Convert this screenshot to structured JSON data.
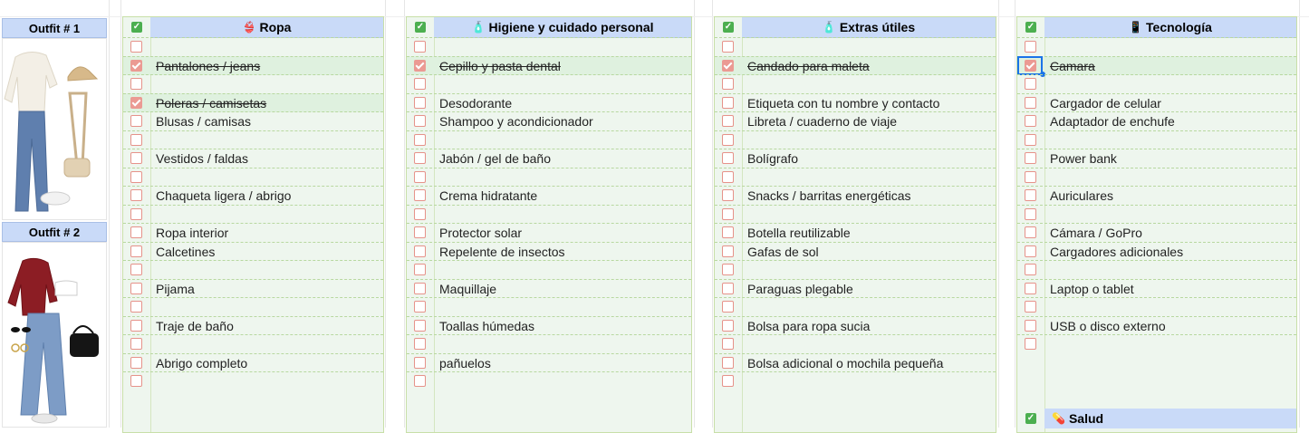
{
  "outfits": [
    {
      "label": "Outfit # 1"
    },
    {
      "label": "Outfit # 2"
    }
  ],
  "categories": [
    {
      "title": "Ropa",
      "icon": "bikini-icon",
      "icon_glyph": "👙",
      "rows": [
        {
          "label": "",
          "checked": false
        },
        {
          "label": "Pantalones / jeans",
          "checked": true
        },
        {
          "label": "",
          "checked": false
        },
        {
          "label": "Poleras / camisetas",
          "checked": true
        },
        {
          "label": "Blusas / camisas",
          "checked": false
        },
        {
          "label": "",
          "checked": false
        },
        {
          "label": "Vestidos / faldas",
          "checked": false
        },
        {
          "label": "",
          "checked": false
        },
        {
          "label": "Chaqueta ligera / abrigo",
          "checked": false
        },
        {
          "label": "",
          "checked": false
        },
        {
          "label": "Ropa interior",
          "checked": false
        },
        {
          "label": "Calcetines",
          "checked": false
        },
        {
          "label": "",
          "checked": false
        },
        {
          "label": "Pijama",
          "checked": false
        },
        {
          "label": "",
          "checked": false
        },
        {
          "label": "Traje de baño",
          "checked": false
        },
        {
          "label": "",
          "checked": false
        },
        {
          "label": "Abrigo completo",
          "checked": false
        },
        {
          "label": "",
          "checked": false
        }
      ]
    },
    {
      "title": "Higiene y cuidado personal",
      "icon": "lotion-bottle-icon",
      "icon_glyph": "🧴",
      "rows": [
        {
          "label": "",
          "checked": false
        },
        {
          "label": "Cepillo y pasta dental",
          "checked": true
        },
        {
          "label": "",
          "checked": false
        },
        {
          "label": "Desodorante",
          "checked": false
        },
        {
          "label": "Shampoo y acondicionador",
          "checked": false
        },
        {
          "label": "",
          "checked": false
        },
        {
          "label": "Jabón / gel de baño",
          "checked": false
        },
        {
          "label": "",
          "checked": false
        },
        {
          "label": "Crema hidratante",
          "checked": false
        },
        {
          "label": "",
          "checked": false
        },
        {
          "label": "Protector solar",
          "checked": false
        },
        {
          "label": "Repelente de insectos",
          "checked": false
        },
        {
          "label": "",
          "checked": false
        },
        {
          "label": "Maquillaje",
          "checked": false
        },
        {
          "label": "",
          "checked": false
        },
        {
          "label": "Toallas húmedas",
          "checked": false
        },
        {
          "label": "",
          "checked": false
        },
        {
          "label": "pañuelos",
          "checked": false
        },
        {
          "label": "",
          "checked": false
        }
      ]
    },
    {
      "title": "Extras útiles",
      "icon": "bottle-icon",
      "icon_glyph": "🧴",
      "rows": [
        {
          "label": "",
          "checked": false
        },
        {
          "label": "Candado para maleta",
          "checked": true
        },
        {
          "label": "",
          "checked": false
        },
        {
          "label": "Etiqueta con tu nombre y contacto",
          "checked": false
        },
        {
          "label": "Libreta / cuaderno de viaje",
          "checked": false
        },
        {
          "label": "",
          "checked": false
        },
        {
          "label": "Bolígrafo",
          "checked": false
        },
        {
          "label": "",
          "checked": false
        },
        {
          "label": "Snacks / barritas energéticas",
          "checked": false
        },
        {
          "label": "",
          "checked": false
        },
        {
          "label": "Botella reutilizable",
          "checked": false
        },
        {
          "label": "Gafas de sol",
          "checked": false
        },
        {
          "label": "",
          "checked": false
        },
        {
          "label": "Paraguas plegable",
          "checked": false
        },
        {
          "label": "",
          "checked": false
        },
        {
          "label": "Bolsa para ropa sucia",
          "checked": false
        },
        {
          "label": "",
          "checked": false
        },
        {
          "label": "Bolsa adicional o mochila pequeña",
          "checked": false
        },
        {
          "label": "",
          "checked": false
        }
      ]
    },
    {
      "title": "Tecnología",
      "icon": "phone-icon",
      "icon_glyph": "📱",
      "rows": [
        {
          "label": "",
          "checked": false
        },
        {
          "label": "Camara",
          "checked": true,
          "selected": true
        },
        {
          "label": "",
          "checked": false
        },
        {
          "label": "Cargador de celular",
          "checked": false
        },
        {
          "label": "Adaptador de enchufe",
          "checked": false
        },
        {
          "label": "",
          "checked": false
        },
        {
          "label": "Power bank",
          "checked": false
        },
        {
          "label": "",
          "checked": false
        },
        {
          "label": "Auriculares",
          "checked": false
        },
        {
          "label": "",
          "checked": false
        },
        {
          "label": "Cámara / GoPro",
          "checked": false
        },
        {
          "label": "Cargadores adicionales",
          "checked": false
        },
        {
          "label": "",
          "checked": false
        },
        {
          "label": "Laptop o tablet",
          "checked": false
        },
        {
          "label": "",
          "checked": false
        },
        {
          "label": "USB o disco externo",
          "checked": false
        },
        {
          "label": "",
          "checked": false
        }
      ]
    }
  ],
  "salud": {
    "title": "Salud",
    "icon": "pill-icon",
    "icon_glyph": "💊"
  },
  "colors": {
    "header_bg": "#c9daf8",
    "block_bg": "#eef6ee",
    "done_row": "#dff1df",
    "checkbox": "#e6928a",
    "header_check": "#4caf50",
    "selection": "#1a73e8"
  }
}
